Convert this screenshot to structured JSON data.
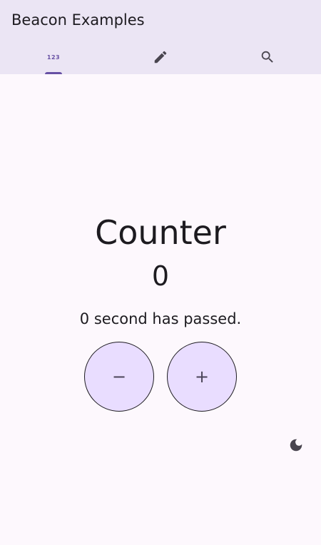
{
  "app_bar": {
    "title": "Beacon Examples",
    "tabs": [
      {
        "icon": "numbers-icon",
        "icon_text": "123",
        "selected": true
      },
      {
        "icon": "edit-icon",
        "selected": false
      },
      {
        "icon": "search-icon",
        "selected": false
      }
    ]
  },
  "counter": {
    "title": "Counter",
    "value": "0",
    "elapsed": "0 second has passed.",
    "decrement_label": "−",
    "increment_label": "+"
  },
  "theme_toggle": {
    "icon": "dark-mode-icon"
  },
  "colors": {
    "app_bar_bg": "#ebe5f4",
    "background": "#fdf8fd",
    "accent": "#6750a4",
    "button_fill": "#e9ddff",
    "text": "#1d1b20",
    "icon": "#49454f"
  }
}
